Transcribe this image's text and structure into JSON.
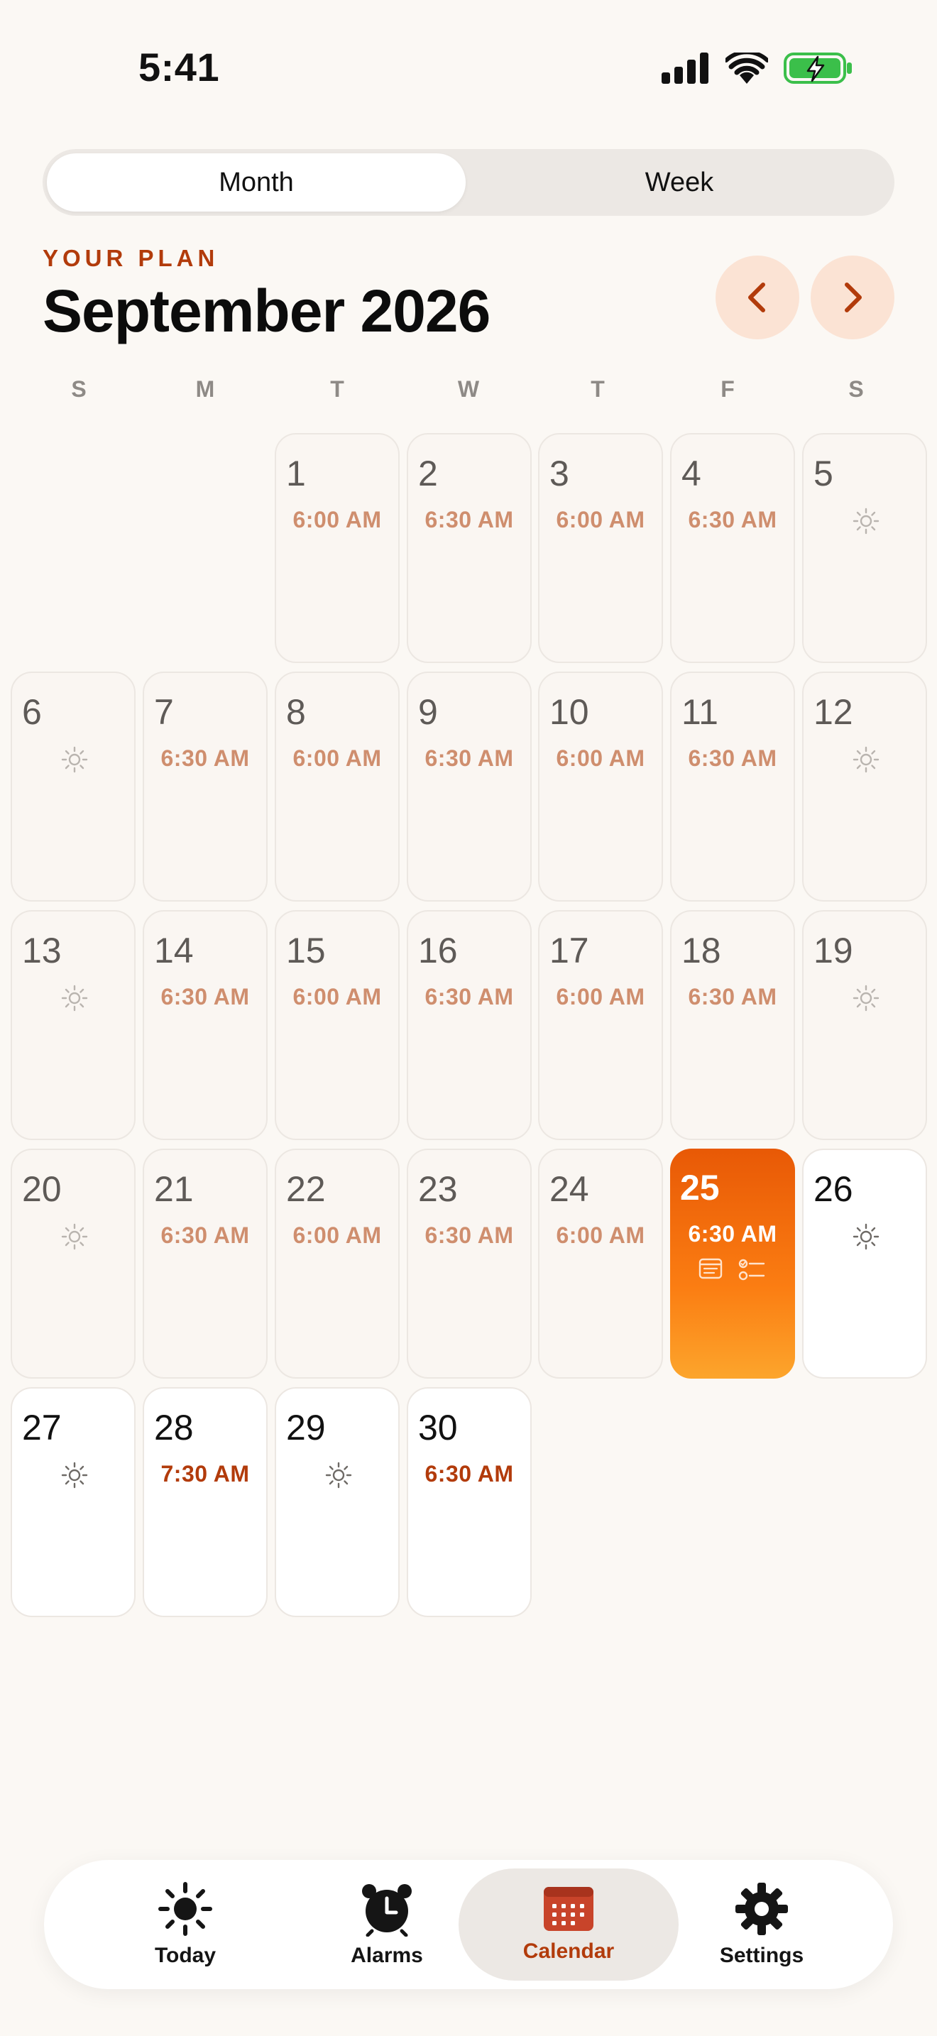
{
  "status": {
    "time": "5:41"
  },
  "view_toggle": {
    "month_label": "Month",
    "week_label": "Week",
    "selected": "Month"
  },
  "header": {
    "eyebrow": "YOUR PLAN",
    "title": "September 2026"
  },
  "weekdays": [
    "S",
    "M",
    "T",
    "W",
    "T",
    "F",
    "S"
  ],
  "days": [
    {
      "n": "1",
      "time": "6:00 AM"
    },
    {
      "n": "2",
      "time": "6:30 AM"
    },
    {
      "n": "3",
      "time": "6:00 AM"
    },
    {
      "n": "4",
      "time": "6:30 AM"
    },
    {
      "n": "5",
      "time": null
    },
    {
      "n": "6",
      "time": null
    },
    {
      "n": "7",
      "time": "6:30 AM"
    },
    {
      "n": "8",
      "time": "6:00 AM"
    },
    {
      "n": "9",
      "time": "6:30 AM"
    },
    {
      "n": "10",
      "time": "6:00 AM"
    },
    {
      "n": "11",
      "time": "6:30 AM"
    },
    {
      "n": "12",
      "time": null
    },
    {
      "n": "13",
      "time": null
    },
    {
      "n": "14",
      "time": "6:30 AM"
    },
    {
      "n": "15",
      "time": "6:00 AM"
    },
    {
      "n": "16",
      "time": "6:30 AM"
    },
    {
      "n": "17",
      "time": "6:00 AM"
    },
    {
      "n": "18",
      "time": "6:30 AM"
    },
    {
      "n": "19",
      "time": null
    },
    {
      "n": "20",
      "time": null
    },
    {
      "n": "21",
      "time": "6:30 AM"
    },
    {
      "n": "22",
      "time": "6:00 AM"
    },
    {
      "n": "23",
      "time": "6:30 AM"
    },
    {
      "n": "24",
      "time": "6:00 AM"
    },
    {
      "n": "25",
      "time": "6:30 AM"
    },
    {
      "n": "26",
      "time": null
    },
    {
      "n": "27",
      "time": null
    },
    {
      "n": "28",
      "time": "7:30 AM"
    },
    {
      "n": "29",
      "time": null
    },
    {
      "n": "30",
      "time": "6:30 AM"
    }
  ],
  "today": "25",
  "tabs": [
    {
      "label": "Today",
      "icon": "sun-icon"
    },
    {
      "label": "Alarms",
      "icon": "alarm-clock-icon"
    },
    {
      "label": "Calendar",
      "icon": "calendar-icon"
    },
    {
      "label": "Settings",
      "icon": "gear-icon"
    }
  ],
  "active_tab": "Calendar",
  "colors": {
    "accent": "#b23b0b",
    "today_gradient_top": "#e85906",
    "today_gradient_bottom": "#fca52c",
    "background": "#fbf8f4"
  }
}
